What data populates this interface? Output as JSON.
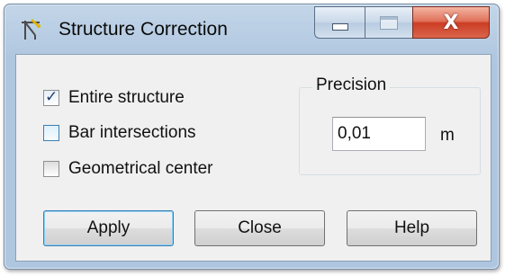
{
  "window": {
    "title": "Structure Correction"
  },
  "title_controls": {
    "minimize_icon": "minimize-icon",
    "maximize_icon": "maximize-icon",
    "close_glyph": "X"
  },
  "options": [
    {
      "label": "Entire structure",
      "checked": true
    },
    {
      "label": "Bar intersections",
      "checked": false
    },
    {
      "label": "Geometrical center",
      "checked": false
    }
  ],
  "precision": {
    "title": "Precision",
    "value": "0,01",
    "unit": "m"
  },
  "buttons": {
    "apply": "Apply",
    "close": "Close",
    "help": "Help"
  }
}
